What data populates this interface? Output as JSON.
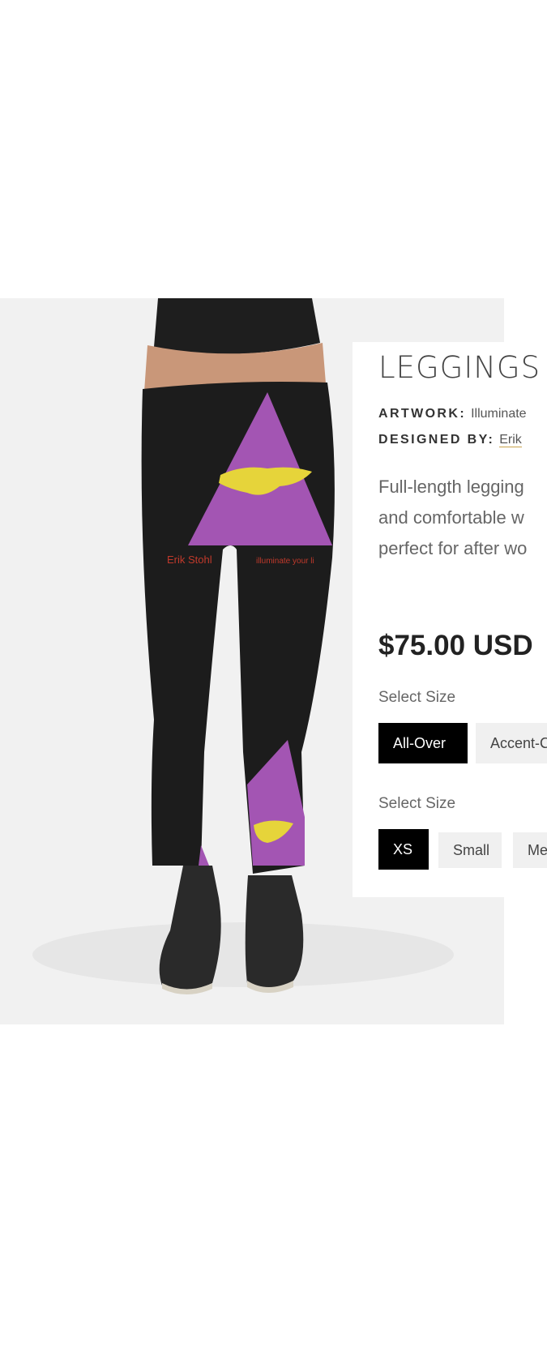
{
  "product": {
    "title": "LEGGINGS",
    "artwork_label": "ARTWORK:",
    "artwork_value": "Illuminate",
    "designer_label": "DESIGNED BY:",
    "designer_value": "Erik",
    "description_lines": [
      "Full-length legging",
      "and comfortable w",
      "perfect for after wo"
    ],
    "price": "$75.00 USD"
  },
  "style_selector": {
    "label": "Select Size",
    "options": [
      "All-Over",
      "Accent-C"
    ],
    "selected": "All-Over"
  },
  "size_selector": {
    "label": "Select Size",
    "options": [
      "XS",
      "Small",
      "Me"
    ],
    "selected": "XS"
  },
  "print_text": {
    "left": "Erik Stohl",
    "right": "illuminate your li"
  },
  "colors": {
    "accent_purple": "#a355b3",
    "legging_black": "#1c1c1c",
    "link_underline": "#c8a24a"
  }
}
